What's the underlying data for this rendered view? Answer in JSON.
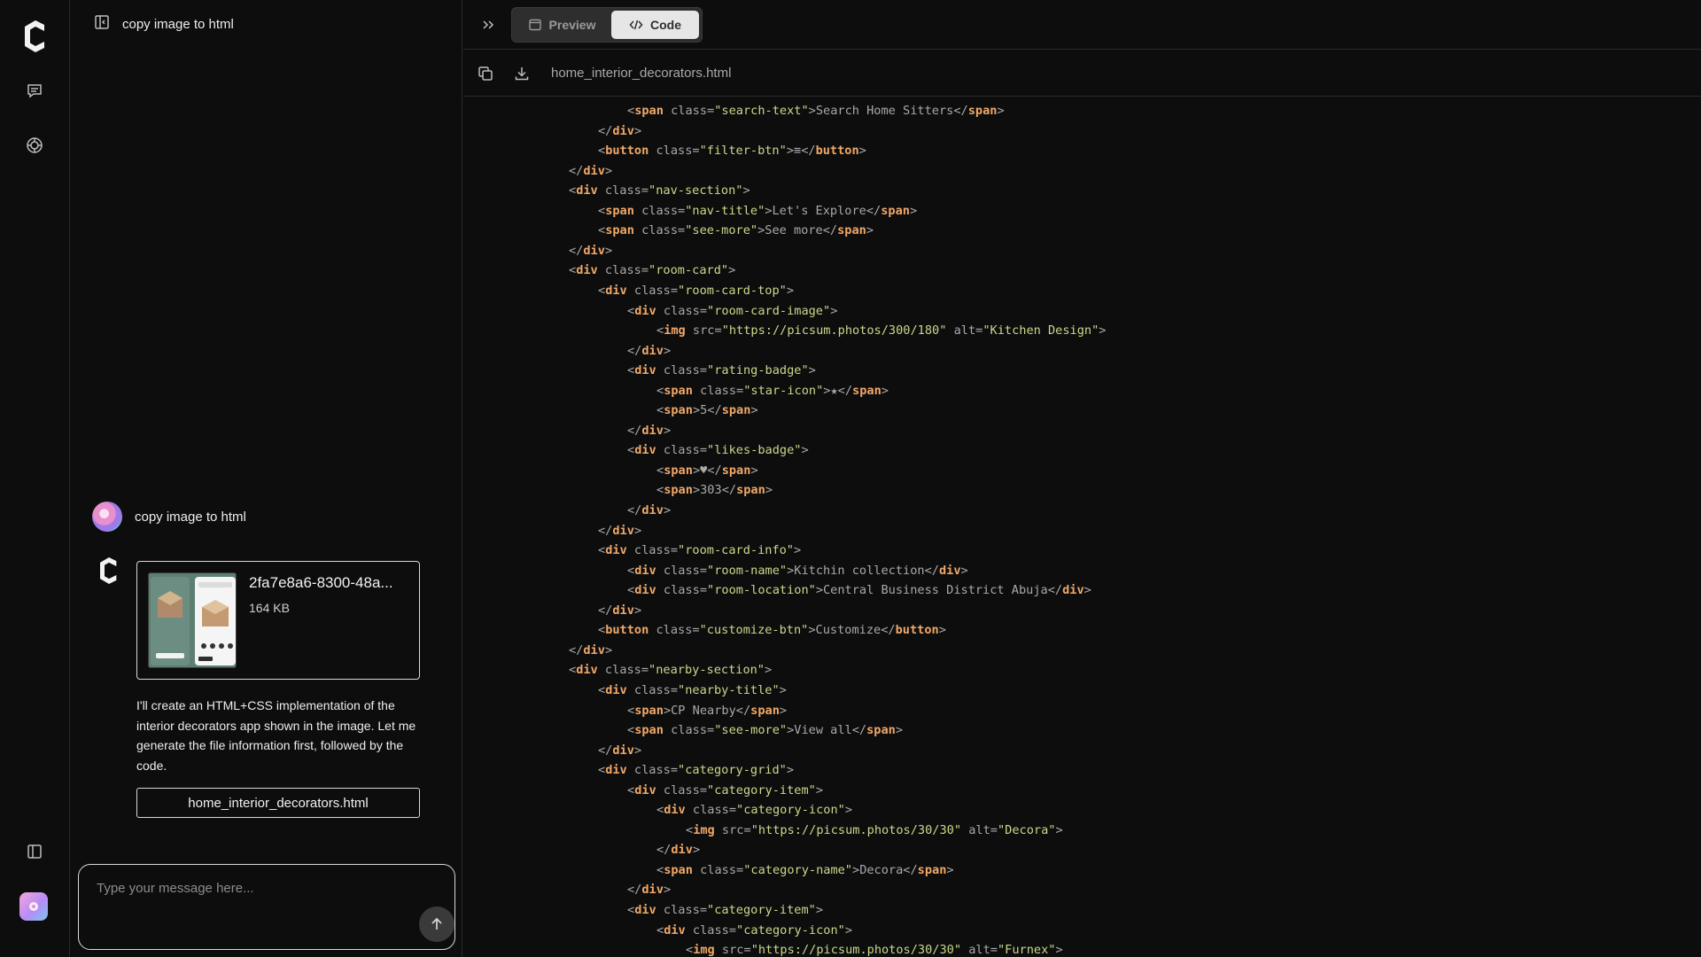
{
  "chat": {
    "title": "copy image to html",
    "user_message": "copy image to html",
    "attachment": {
      "name": "2fa7e8a6-8300-48a...",
      "size": "164 KB"
    },
    "assistant_message": "I'll create an HTML+CSS implementation of the interior decorators app shown in the image. Let me generate the file information first, followed by the code.",
    "file_button_label": "home_interior_decorators.html",
    "composer_placeholder": "Type your message here..."
  },
  "code_panel": {
    "tabs": {
      "preview": "Preview",
      "code": "Code"
    },
    "filename": "home_interior_decorators.html"
  },
  "code_lines": [
    {
      "indent": 6,
      "tokens": [
        [
          "p",
          "<"
        ],
        [
          "t",
          "span"
        ],
        [
          "a",
          " class"
        ],
        [
          "p",
          "="
        ],
        [
          "s",
          "\"search-text\""
        ],
        [
          "p",
          ">"
        ],
        [
          "x",
          "Search Home Sitters"
        ],
        [
          "p",
          "</"
        ],
        [
          "t",
          "span"
        ],
        [
          "p",
          ">"
        ]
      ]
    },
    {
      "indent": 5,
      "tokens": [
        [
          "p",
          "</"
        ],
        [
          "t",
          "div"
        ],
        [
          "p",
          ">"
        ]
      ]
    },
    {
      "indent": 5,
      "tokens": [
        [
          "p",
          "<"
        ],
        [
          "t",
          "button"
        ],
        [
          "a",
          " class"
        ],
        [
          "p",
          "="
        ],
        [
          "s",
          "\"filter-btn\""
        ],
        [
          "p",
          ">"
        ],
        [
          "x",
          "≡"
        ],
        [
          "p",
          "</"
        ],
        [
          "t",
          "button"
        ],
        [
          "p",
          ">"
        ]
      ]
    },
    {
      "indent": 4,
      "tokens": [
        [
          "p",
          "</"
        ],
        [
          "t",
          "div"
        ],
        [
          "p",
          ">"
        ]
      ]
    },
    {
      "indent": 4,
      "tokens": [
        [
          "p",
          "<"
        ],
        [
          "t",
          "div"
        ],
        [
          "a",
          " class"
        ],
        [
          "p",
          "="
        ],
        [
          "s",
          "\"nav-section\""
        ],
        [
          "p",
          ">"
        ]
      ]
    },
    {
      "indent": 5,
      "tokens": [
        [
          "p",
          "<"
        ],
        [
          "t",
          "span"
        ],
        [
          "a",
          " class"
        ],
        [
          "p",
          "="
        ],
        [
          "s",
          "\"nav-title\""
        ],
        [
          "p",
          ">"
        ],
        [
          "x",
          "Let's Explore"
        ],
        [
          "p",
          "</"
        ],
        [
          "t",
          "span"
        ],
        [
          "p",
          ">"
        ]
      ]
    },
    {
      "indent": 5,
      "tokens": [
        [
          "p",
          "<"
        ],
        [
          "t",
          "span"
        ],
        [
          "a",
          " class"
        ],
        [
          "p",
          "="
        ],
        [
          "s",
          "\"see-more\""
        ],
        [
          "p",
          ">"
        ],
        [
          "x",
          "See more"
        ],
        [
          "p",
          "</"
        ],
        [
          "t",
          "span"
        ],
        [
          "p",
          ">"
        ]
      ]
    },
    {
      "indent": 4,
      "tokens": [
        [
          "p",
          "</"
        ],
        [
          "t",
          "div"
        ],
        [
          "p",
          ">"
        ]
      ]
    },
    {
      "indent": 4,
      "tokens": [
        [
          "p",
          "<"
        ],
        [
          "t",
          "div"
        ],
        [
          "a",
          " class"
        ],
        [
          "p",
          "="
        ],
        [
          "s",
          "\"room-card\""
        ],
        [
          "p",
          ">"
        ]
      ]
    },
    {
      "indent": 5,
      "tokens": [
        [
          "p",
          "<"
        ],
        [
          "t",
          "div"
        ],
        [
          "a",
          " class"
        ],
        [
          "p",
          "="
        ],
        [
          "s",
          "\"room-card-top\""
        ],
        [
          "p",
          ">"
        ]
      ]
    },
    {
      "indent": 6,
      "tokens": [
        [
          "p",
          "<"
        ],
        [
          "t",
          "div"
        ],
        [
          "a",
          " class"
        ],
        [
          "p",
          "="
        ],
        [
          "s",
          "\"room-card-image\""
        ],
        [
          "p",
          ">"
        ]
      ]
    },
    {
      "indent": 7,
      "tokens": [
        [
          "p",
          "<"
        ],
        [
          "t",
          "img"
        ],
        [
          "a",
          " src"
        ],
        [
          "p",
          "="
        ],
        [
          "s",
          "\"https://picsum.photos/300/180\""
        ],
        [
          "a",
          " alt"
        ],
        [
          "p",
          "="
        ],
        [
          "s",
          "\"Kitchen Design\""
        ],
        [
          "p",
          ">"
        ]
      ]
    },
    {
      "indent": 6,
      "tokens": [
        [
          "p",
          "</"
        ],
        [
          "t",
          "div"
        ],
        [
          "p",
          ">"
        ]
      ]
    },
    {
      "indent": 6,
      "tokens": [
        [
          "p",
          "<"
        ],
        [
          "t",
          "div"
        ],
        [
          "a",
          " class"
        ],
        [
          "p",
          "="
        ],
        [
          "s",
          "\"rating-badge\""
        ],
        [
          "p",
          ">"
        ]
      ]
    },
    {
      "indent": 7,
      "tokens": [
        [
          "p",
          "<"
        ],
        [
          "t",
          "span"
        ],
        [
          "a",
          " class"
        ],
        [
          "p",
          "="
        ],
        [
          "s",
          "\"star-icon\""
        ],
        [
          "p",
          ">"
        ],
        [
          "x",
          "★"
        ],
        [
          "p",
          "</"
        ],
        [
          "t",
          "span"
        ],
        [
          "p",
          ">"
        ]
      ]
    },
    {
      "indent": 7,
      "tokens": [
        [
          "p",
          "<"
        ],
        [
          "t",
          "span"
        ],
        [
          "p",
          ">"
        ],
        [
          "x",
          "5"
        ],
        [
          "p",
          "</"
        ],
        [
          "t",
          "span"
        ],
        [
          "p",
          ">"
        ]
      ]
    },
    {
      "indent": 6,
      "tokens": [
        [
          "p",
          "</"
        ],
        [
          "t",
          "div"
        ],
        [
          "p",
          ">"
        ]
      ]
    },
    {
      "indent": 6,
      "tokens": [
        [
          "p",
          "<"
        ],
        [
          "t",
          "div"
        ],
        [
          "a",
          " class"
        ],
        [
          "p",
          "="
        ],
        [
          "s",
          "\"likes-badge\""
        ],
        [
          "p",
          ">"
        ]
      ]
    },
    {
      "indent": 7,
      "tokens": [
        [
          "p",
          "<"
        ],
        [
          "t",
          "span"
        ],
        [
          "p",
          ">"
        ],
        [
          "x",
          "♥"
        ],
        [
          "p",
          "</"
        ],
        [
          "t",
          "span"
        ],
        [
          "p",
          ">"
        ]
      ]
    },
    {
      "indent": 7,
      "tokens": [
        [
          "p",
          "<"
        ],
        [
          "t",
          "span"
        ],
        [
          "p",
          ">"
        ],
        [
          "x",
          "303"
        ],
        [
          "p",
          "</"
        ],
        [
          "t",
          "span"
        ],
        [
          "p",
          ">"
        ]
      ]
    },
    {
      "indent": 6,
      "tokens": [
        [
          "p",
          "</"
        ],
        [
          "t",
          "div"
        ],
        [
          "p",
          ">"
        ]
      ]
    },
    {
      "indent": 5,
      "tokens": [
        [
          "p",
          "</"
        ],
        [
          "t",
          "div"
        ],
        [
          "p",
          ">"
        ]
      ]
    },
    {
      "indent": 5,
      "tokens": [
        [
          "p",
          "<"
        ],
        [
          "t",
          "div"
        ],
        [
          "a",
          " class"
        ],
        [
          "p",
          "="
        ],
        [
          "s",
          "\"room-card-info\""
        ],
        [
          "p",
          ">"
        ]
      ]
    },
    {
      "indent": 6,
      "tokens": [
        [
          "p",
          "<"
        ],
        [
          "t",
          "div"
        ],
        [
          "a",
          " class"
        ],
        [
          "p",
          "="
        ],
        [
          "s",
          "\"room-name\""
        ],
        [
          "p",
          ">"
        ],
        [
          "x",
          "Kitchin collection"
        ],
        [
          "p",
          "</"
        ],
        [
          "t",
          "div"
        ],
        [
          "p",
          ">"
        ]
      ]
    },
    {
      "indent": 6,
      "tokens": [
        [
          "p",
          "<"
        ],
        [
          "t",
          "div"
        ],
        [
          "a",
          " class"
        ],
        [
          "p",
          "="
        ],
        [
          "s",
          "\"room-location\""
        ],
        [
          "p",
          ">"
        ],
        [
          "x",
          "Central Business District Abuja"
        ],
        [
          "p",
          "</"
        ],
        [
          "t",
          "div"
        ],
        [
          "p",
          ">"
        ]
      ]
    },
    {
      "indent": 5,
      "tokens": [
        [
          "p",
          "</"
        ],
        [
          "t",
          "div"
        ],
        [
          "p",
          ">"
        ]
      ]
    },
    {
      "indent": 5,
      "tokens": [
        [
          "p",
          "<"
        ],
        [
          "t",
          "button"
        ],
        [
          "a",
          " class"
        ],
        [
          "p",
          "="
        ],
        [
          "s",
          "\"customize-btn\""
        ],
        [
          "p",
          ">"
        ],
        [
          "x",
          "Customize"
        ],
        [
          "p",
          "</"
        ],
        [
          "t",
          "button"
        ],
        [
          "p",
          ">"
        ]
      ]
    },
    {
      "indent": 4,
      "tokens": [
        [
          "p",
          "</"
        ],
        [
          "t",
          "div"
        ],
        [
          "p",
          ">"
        ]
      ]
    },
    {
      "indent": 4,
      "tokens": [
        [
          "p",
          "<"
        ],
        [
          "t",
          "div"
        ],
        [
          "a",
          " class"
        ],
        [
          "p",
          "="
        ],
        [
          "s",
          "\"nearby-section\""
        ],
        [
          "p",
          ">"
        ]
      ]
    },
    {
      "indent": 5,
      "tokens": [
        [
          "p",
          "<"
        ],
        [
          "t",
          "div"
        ],
        [
          "a",
          " class"
        ],
        [
          "p",
          "="
        ],
        [
          "s",
          "\"nearby-title\""
        ],
        [
          "p",
          ">"
        ]
      ]
    },
    {
      "indent": 6,
      "tokens": [
        [
          "p",
          "<"
        ],
        [
          "t",
          "span"
        ],
        [
          "p",
          ">"
        ],
        [
          "x",
          "CP Nearby"
        ],
        [
          "p",
          "</"
        ],
        [
          "t",
          "span"
        ],
        [
          "p",
          ">"
        ]
      ]
    },
    {
      "indent": 6,
      "tokens": [
        [
          "p",
          "<"
        ],
        [
          "t",
          "span"
        ],
        [
          "a",
          " class"
        ],
        [
          "p",
          "="
        ],
        [
          "s",
          "\"see-more\""
        ],
        [
          "p",
          ">"
        ],
        [
          "x",
          "View all"
        ],
        [
          "p",
          "</"
        ],
        [
          "t",
          "span"
        ],
        [
          "p",
          ">"
        ]
      ]
    },
    {
      "indent": 5,
      "tokens": [
        [
          "p",
          "</"
        ],
        [
          "t",
          "div"
        ],
        [
          "p",
          ">"
        ]
      ]
    },
    {
      "indent": 5,
      "tokens": [
        [
          "p",
          "<"
        ],
        [
          "t",
          "div"
        ],
        [
          "a",
          " class"
        ],
        [
          "p",
          "="
        ],
        [
          "s",
          "\"category-grid\""
        ],
        [
          "p",
          ">"
        ]
      ]
    },
    {
      "indent": 6,
      "tokens": [
        [
          "p",
          "<"
        ],
        [
          "t",
          "div"
        ],
        [
          "a",
          " class"
        ],
        [
          "p",
          "="
        ],
        [
          "s",
          "\"category-item\""
        ],
        [
          "p",
          ">"
        ]
      ]
    },
    {
      "indent": 7,
      "tokens": [
        [
          "p",
          "<"
        ],
        [
          "t",
          "div"
        ],
        [
          "a",
          " class"
        ],
        [
          "p",
          "="
        ],
        [
          "s",
          "\"category-icon\""
        ],
        [
          "p",
          ">"
        ]
      ]
    },
    {
      "indent": 8,
      "tokens": [
        [
          "p",
          "<"
        ],
        [
          "t",
          "img"
        ],
        [
          "a",
          " src"
        ],
        [
          "p",
          "="
        ],
        [
          "s",
          "\"https://picsum.photos/30/30\""
        ],
        [
          "a",
          " alt"
        ],
        [
          "p",
          "="
        ],
        [
          "s",
          "\"Decora\""
        ],
        [
          "p",
          ">"
        ]
      ]
    },
    {
      "indent": 7,
      "tokens": [
        [
          "p",
          "</"
        ],
        [
          "t",
          "div"
        ],
        [
          "p",
          ">"
        ]
      ]
    },
    {
      "indent": 7,
      "tokens": [
        [
          "p",
          "<"
        ],
        [
          "t",
          "span"
        ],
        [
          "a",
          " class"
        ],
        [
          "p",
          "="
        ],
        [
          "s",
          "\"category-name\""
        ],
        [
          "p",
          ">"
        ],
        [
          "x",
          "Decora"
        ],
        [
          "p",
          "</"
        ],
        [
          "t",
          "span"
        ],
        [
          "p",
          ">"
        ]
      ]
    },
    {
      "indent": 6,
      "tokens": [
        [
          "p",
          "</"
        ],
        [
          "t",
          "div"
        ],
        [
          "p",
          ">"
        ]
      ]
    },
    {
      "indent": 6,
      "tokens": [
        [
          "p",
          "<"
        ],
        [
          "t",
          "div"
        ],
        [
          "a",
          " class"
        ],
        [
          "p",
          "="
        ],
        [
          "s",
          "\"category-item\""
        ],
        [
          "p",
          ">"
        ]
      ]
    },
    {
      "indent": 7,
      "tokens": [
        [
          "p",
          "<"
        ],
        [
          "t",
          "div"
        ],
        [
          "a",
          " class"
        ],
        [
          "p",
          "="
        ],
        [
          "s",
          "\"category-icon\""
        ],
        [
          "p",
          ">"
        ]
      ]
    },
    {
      "indent": 8,
      "tokens": [
        [
          "p",
          "<"
        ],
        [
          "t",
          "img"
        ],
        [
          "a",
          " src"
        ],
        [
          "p",
          "="
        ],
        [
          "s",
          "\"https://picsum.photos/30/30\""
        ],
        [
          "a",
          " alt"
        ],
        [
          "p",
          "="
        ],
        [
          "s",
          "\"Furnex\""
        ],
        [
          "p",
          ">"
        ]
      ]
    }
  ],
  "colors": {
    "background": "#0d0d0d",
    "tag": "#f0a868",
    "string": "#c8d98a",
    "text": "#a9a9a9",
    "code_tab_active": "#e6e6e6"
  },
  "icons": [
    "app-logo-icon",
    "chat-icon",
    "openai-icon",
    "sidebar-toggle-icon",
    "copy-icon",
    "download-icon",
    "preview-window-icon",
    "code-brackets-icon",
    "send-arrow-icon",
    "double-chevron-right-icon"
  ]
}
